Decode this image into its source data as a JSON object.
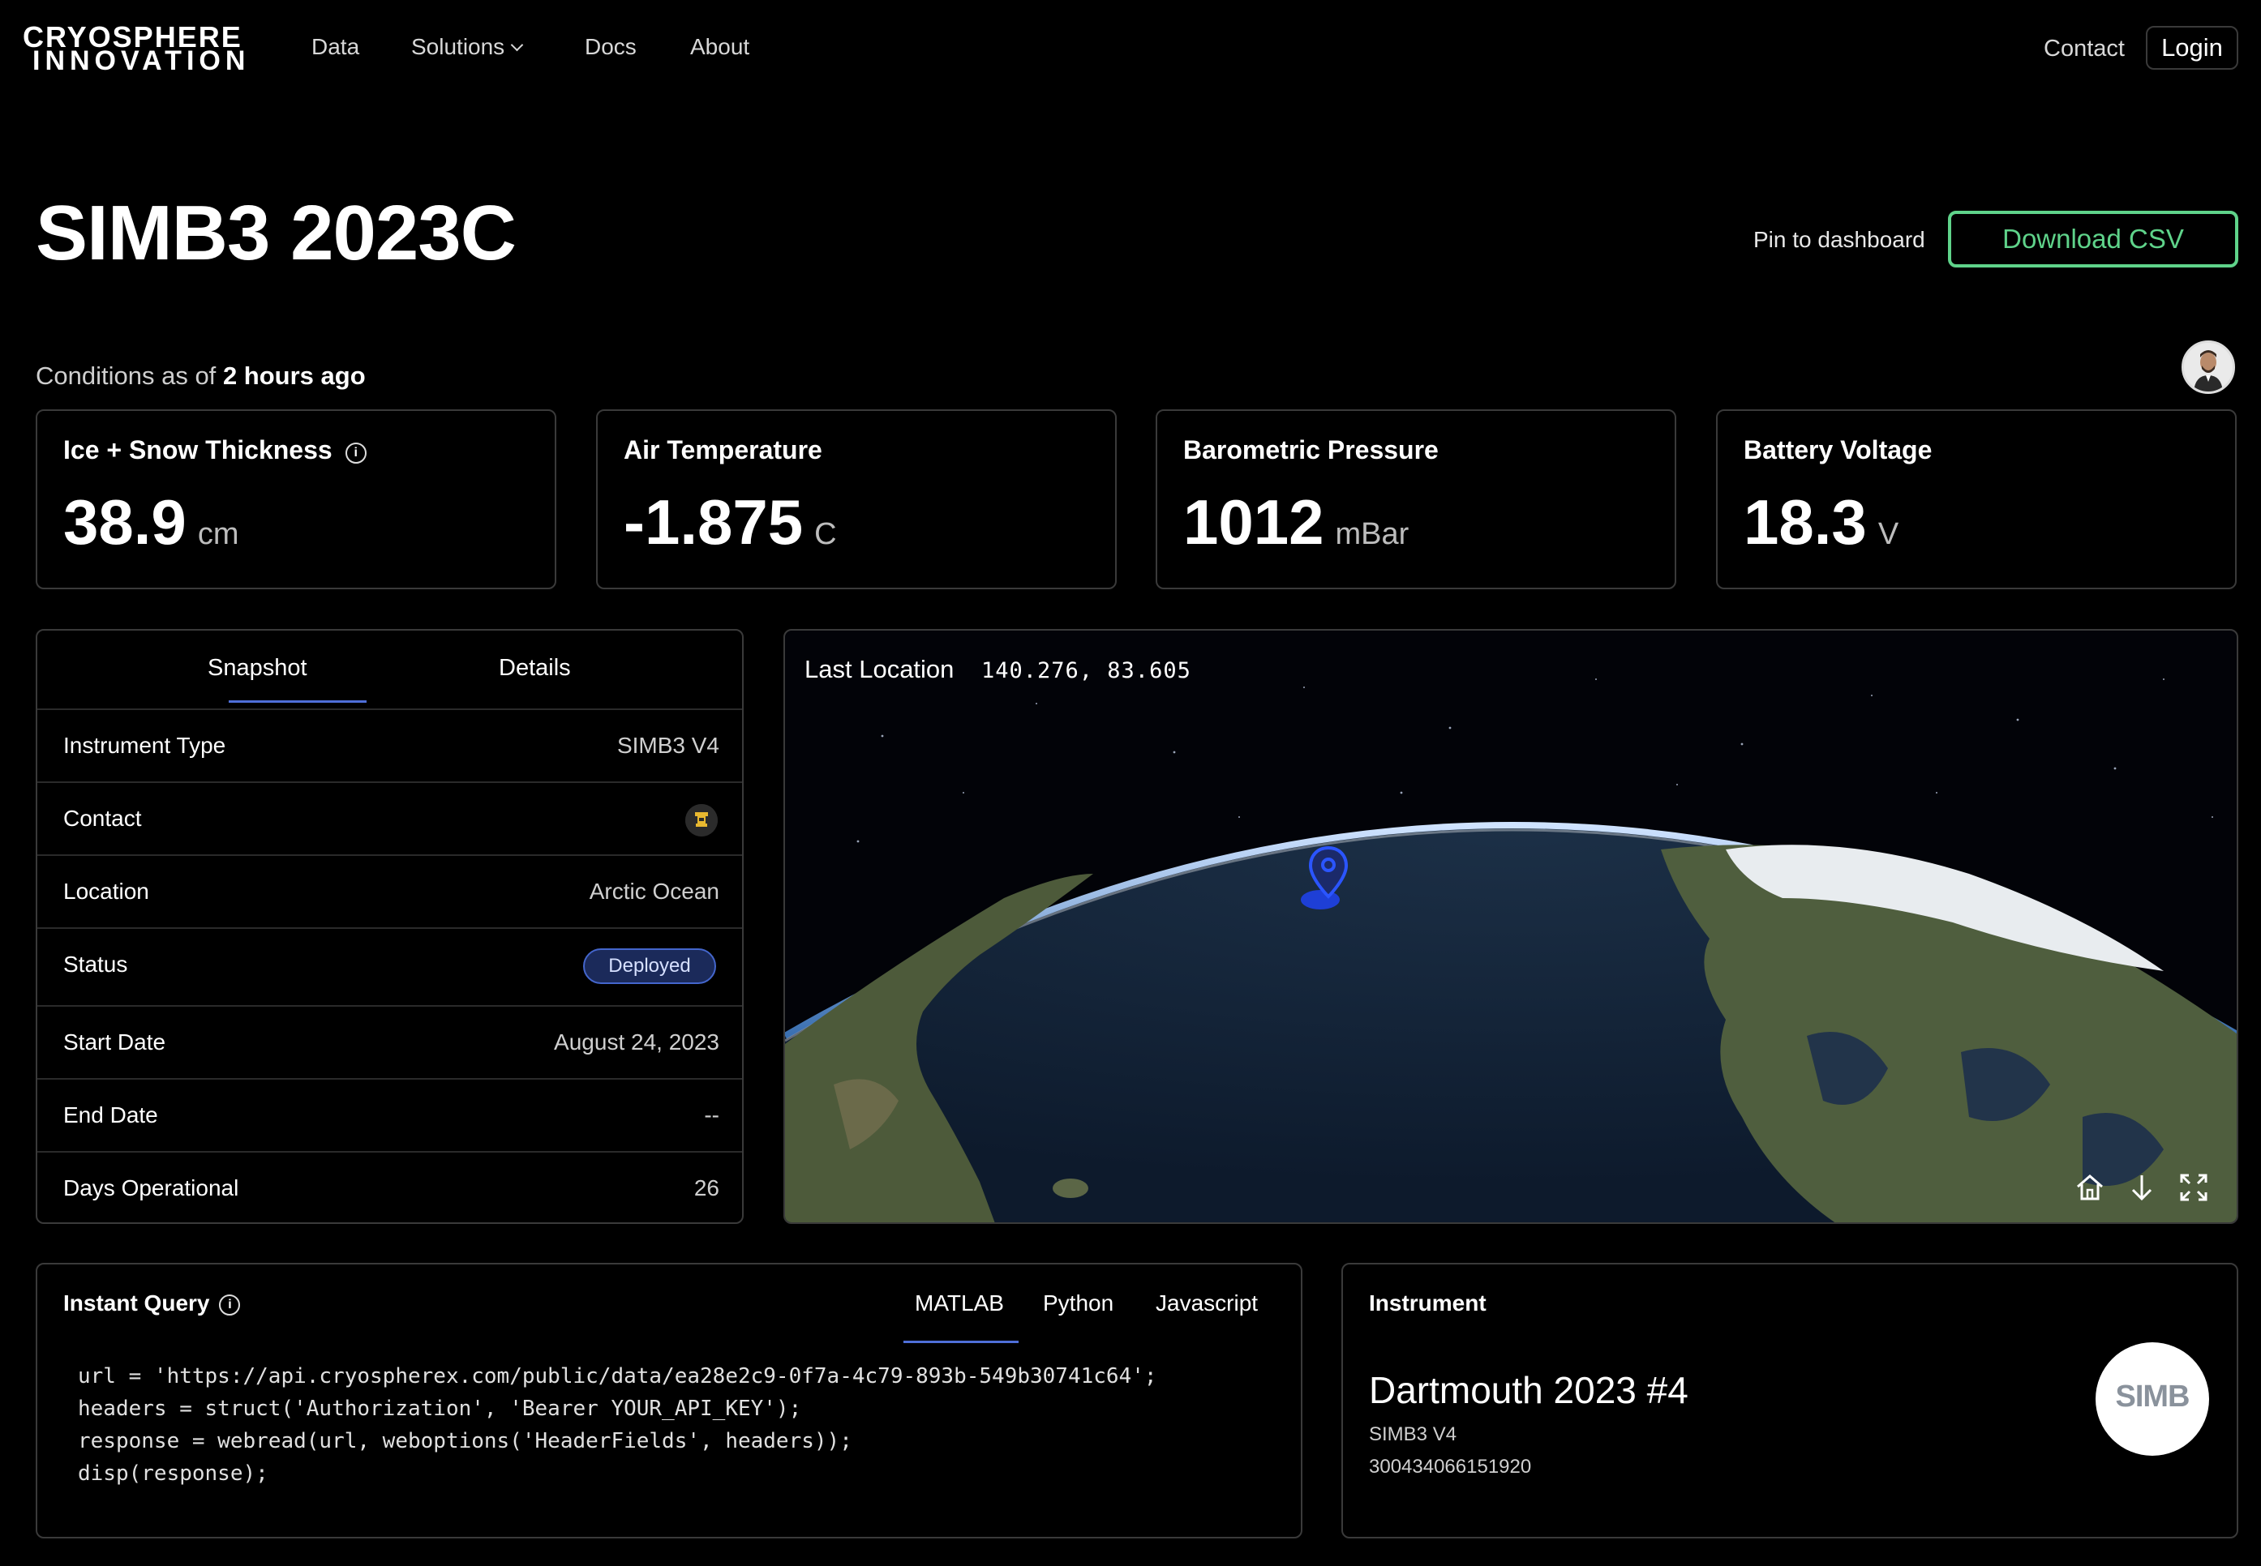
{
  "nav": {
    "logo_line1": "CRYOSPHERE",
    "logo_line2": "INNOVATION",
    "links": [
      "Data",
      "Solutions",
      "Docs",
      "About"
    ],
    "contact": "Contact",
    "login": "Login"
  },
  "header": {
    "title": "SIMB3 2023C",
    "pin_label": "Pin to dashboard",
    "download_label": "Download CSV",
    "accent_color": "#5fd38a"
  },
  "conditions": {
    "prefix": "Conditions as of",
    "time": "2 hours ago"
  },
  "metrics": [
    {
      "label": "Ice + Snow Thickness",
      "value": "38.9",
      "unit": "cm",
      "info": "i"
    },
    {
      "label": "Air Temperature",
      "value": "-1.875",
      "unit": "C"
    },
    {
      "label": "Barometric Pressure",
      "value": "1012",
      "unit": "mBar"
    },
    {
      "label": "Battery Voltage",
      "value": "18.3",
      "unit": "V"
    }
  ],
  "snapshot": {
    "tabs": [
      "Snapshot",
      "Details"
    ],
    "rows": [
      {
        "key": "Instrument Type",
        "value": "SIMB3 V4"
      },
      {
        "key": "Contact",
        "value": ""
      },
      {
        "key": "Location",
        "value": "Arctic Ocean"
      },
      {
        "key": "Status",
        "value": "Deployed"
      },
      {
        "key": "Start Date",
        "value": "August 24, 2023"
      },
      {
        "key": "End Date",
        "value": "--"
      },
      {
        "key": "Days Operational",
        "value": "26"
      }
    ],
    "status_color": "#4466cc"
  },
  "map": {
    "label": "Last Location",
    "coords": "140.276, 83.605",
    "controls": [
      "home-icon",
      "arrow-down-icon",
      "fullscreen-icon"
    ]
  },
  "query": {
    "title": "Instant Query",
    "info": "i",
    "tabs": [
      "MATLAB",
      "Python",
      "Javascript"
    ],
    "code": "url = 'https://api.cryospherex.com/public/data/ea28e2c9-0f7a-4c79-893b-549b30741c64';\nheaders = struct('Authorization', 'Bearer YOUR_API_KEY');\nresponse = webread(url, weboptions('HeaderFields', headers));\ndisp(response);"
  },
  "instrument": {
    "title": "Instrument",
    "name": "Dartmouth 2023 #4",
    "model": "SIMB3 V4",
    "serial": "300434066151920",
    "logo_text": "SIMB"
  }
}
